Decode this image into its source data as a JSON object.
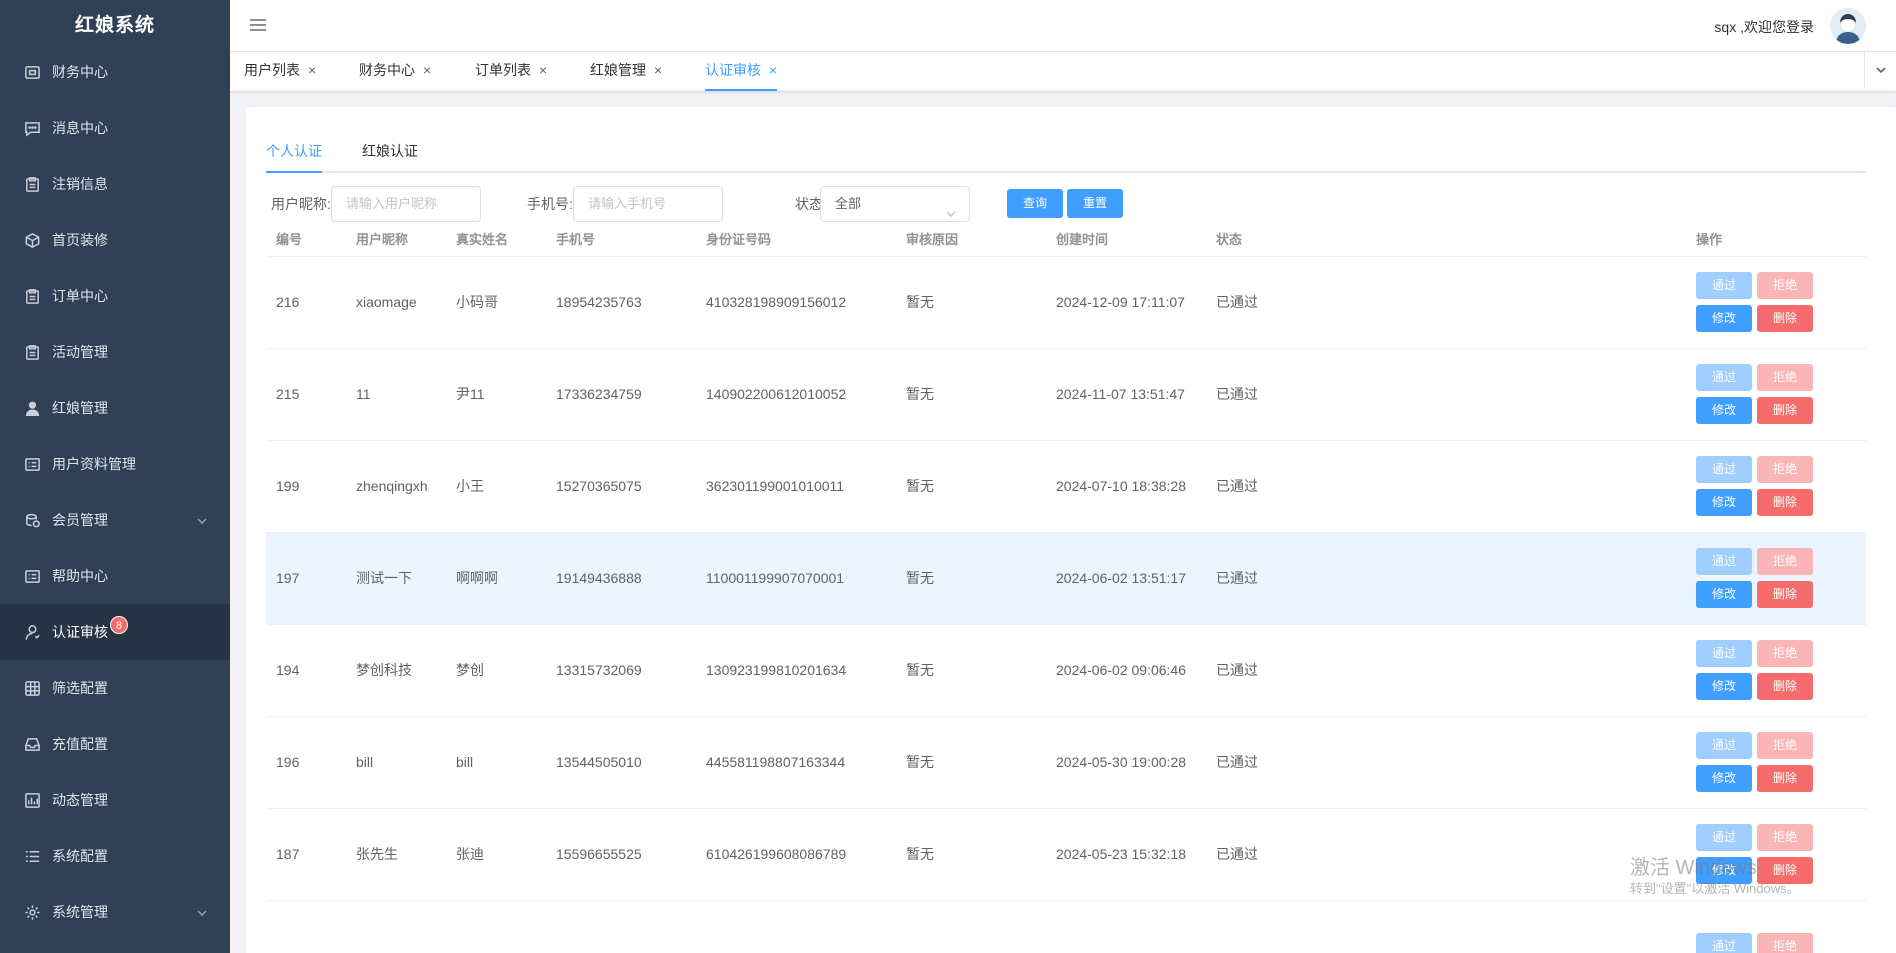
{
  "brand": "红娘系统",
  "menu": [
    {
      "label": "财务中心",
      "icon": "wallet-icon"
    },
    {
      "label": "消息中心",
      "icon": "message-icon"
    },
    {
      "label": "注销信息",
      "icon": "clipboard-icon"
    },
    {
      "label": "首页装修",
      "icon": "cube-icon"
    },
    {
      "label": "订单中心",
      "icon": "clipboard-icon"
    },
    {
      "label": "活动管理",
      "icon": "clipboard-icon"
    },
    {
      "label": "红娘管理",
      "icon": "user-icon"
    },
    {
      "label": "用户资料管理",
      "icon": "list-icon"
    },
    {
      "label": "会员管理",
      "icon": "coins-icon"
    },
    {
      "label": "帮助中心",
      "icon": "list-icon"
    },
    {
      "label": "认证审核",
      "icon": "user-outline-icon",
      "badge": "8"
    },
    {
      "label": "筛选配置",
      "icon": "grid-icon"
    },
    {
      "label": "充值配置",
      "icon": "inbox-icon"
    },
    {
      "label": "动态管理",
      "icon": "picture-icon"
    },
    {
      "label": "系统配置",
      "icon": "menu-list-icon"
    },
    {
      "label": "系统管理",
      "icon": "gear-icon"
    }
  ],
  "header": {
    "welcome": "sqx ,欢迎您登录"
  },
  "tags": [
    {
      "label": "用户列表",
      "close": "×"
    },
    {
      "label": "财务中心",
      "close": "×"
    },
    {
      "label": "订单列表",
      "close": "×"
    },
    {
      "label": "红娘管理",
      "close": "×"
    },
    {
      "label": "认证审核",
      "close": "×"
    }
  ],
  "subtabs": [
    "个人认证",
    "红娘认证"
  ],
  "filters": {
    "nickname_label": "用户昵称:",
    "nickname_placeholder": "请输入用户昵称",
    "phone_label": "手机号:",
    "phone_placeholder": "请输入手机号",
    "status_label": "状态:",
    "status_value": "全部",
    "query_label": "查询",
    "reset_label": "重置"
  },
  "table": {
    "headers": [
      "编号",
      "用户昵称",
      "真实姓名",
      "手机号",
      "身份证号码",
      "审核原因",
      "创建时间",
      "状态",
      "操作"
    ],
    "rows": [
      {
        "id": "216",
        "nickname": "xiaomage",
        "realname": "小码哥",
        "phone": "18954235763",
        "idcard": "410328198909156012",
        "reason": "暂无",
        "created": "2024-12-09 17:11:07",
        "status": "已通过"
      },
      {
        "id": "215",
        "nickname": "11",
        "realname": "尹11",
        "phone": "17336234759",
        "idcard": "140902200612010052",
        "reason": "暂无",
        "created": "2024-11-07 13:51:47",
        "status": "已通过"
      },
      {
        "id": "199",
        "nickname": "zhenqingxh",
        "realname": "小王",
        "phone": "15270365075",
        "idcard": "362301199001010011",
        "reason": "暂无",
        "created": "2024-07-10 18:38:28",
        "status": "已通过"
      },
      {
        "id": "197",
        "nickname": "测试一下",
        "realname": "啊啊啊",
        "phone": "19149436888",
        "idcard": "110001199907070001",
        "reason": "暂无",
        "created": "2024-06-02 13:51:17",
        "status": "已通过"
      },
      {
        "id": "194",
        "nickname": "梦创科技",
        "realname": "梦创",
        "phone": "13315732069",
        "idcard": "130923199810201634",
        "reason": "暂无",
        "created": "2024-06-02 09:06:46",
        "status": "已通过"
      },
      {
        "id": "196",
        "nickname": "bill",
        "realname": "bill",
        "phone": "13544505010",
        "idcard": "445581198807163344",
        "reason": "暂无",
        "created": "2024-05-30 19:00:28",
        "status": "已通过"
      },
      {
        "id": "187",
        "nickname": "张先生",
        "realname": "张迪",
        "phone": "15596655525",
        "idcard": "610426199608086789",
        "reason": "暂无",
        "created": "2024-05-23 15:32:18",
        "status": "已通过"
      }
    ],
    "actions": {
      "pass": "通过",
      "reject": "拒绝",
      "edit": "修改",
      "delete": "删除"
    }
  },
  "watermark": {
    "title": "激活 Windows",
    "subtitle": "转到\"设置\"以激活 Windows。"
  }
}
